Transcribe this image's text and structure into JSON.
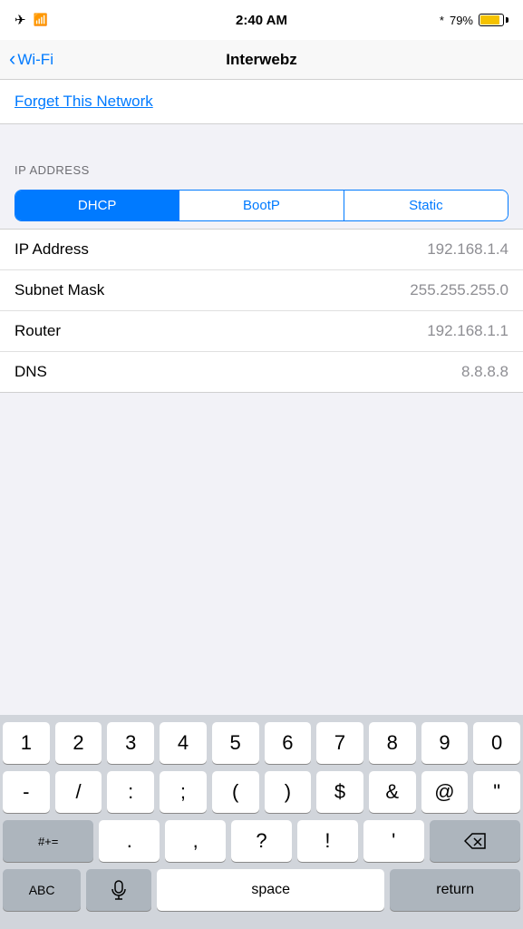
{
  "statusBar": {
    "time": "2:40 AM",
    "battery": "79%"
  },
  "nav": {
    "backLabel": "Wi-Fi",
    "title": "Interwebz"
  },
  "forgetSection": {
    "text": "Forget This Network"
  },
  "ipSection": {
    "header": "IP ADDRESS",
    "segments": [
      "DHCP",
      "BootP",
      "Static"
    ],
    "activeSegment": 0,
    "rows": [
      {
        "label": "IP Address",
        "value": "192.168.1.4"
      },
      {
        "label": "Subnet Mask",
        "value": "255.255.255.0"
      },
      {
        "label": "Router",
        "value": "192.168.1.1"
      },
      {
        "label": "DNS",
        "value": "8.8.8.8"
      }
    ]
  },
  "keyboard": {
    "row1": [
      "1",
      "2",
      "3",
      "4",
      "5",
      "6",
      "7",
      "8",
      "9",
      "0"
    ],
    "row2": [
      "-",
      "/",
      ":",
      ";",
      " ( ",
      " ) ",
      "$",
      "&",
      "@",
      "\""
    ],
    "row3Left": [
      "#+="
    ],
    "row3Mid": [
      ".",
      "  ,",
      "?",
      "!",
      "'"
    ],
    "row4": {
      "abc": "ABC",
      "space": "space",
      "return": "return"
    }
  }
}
